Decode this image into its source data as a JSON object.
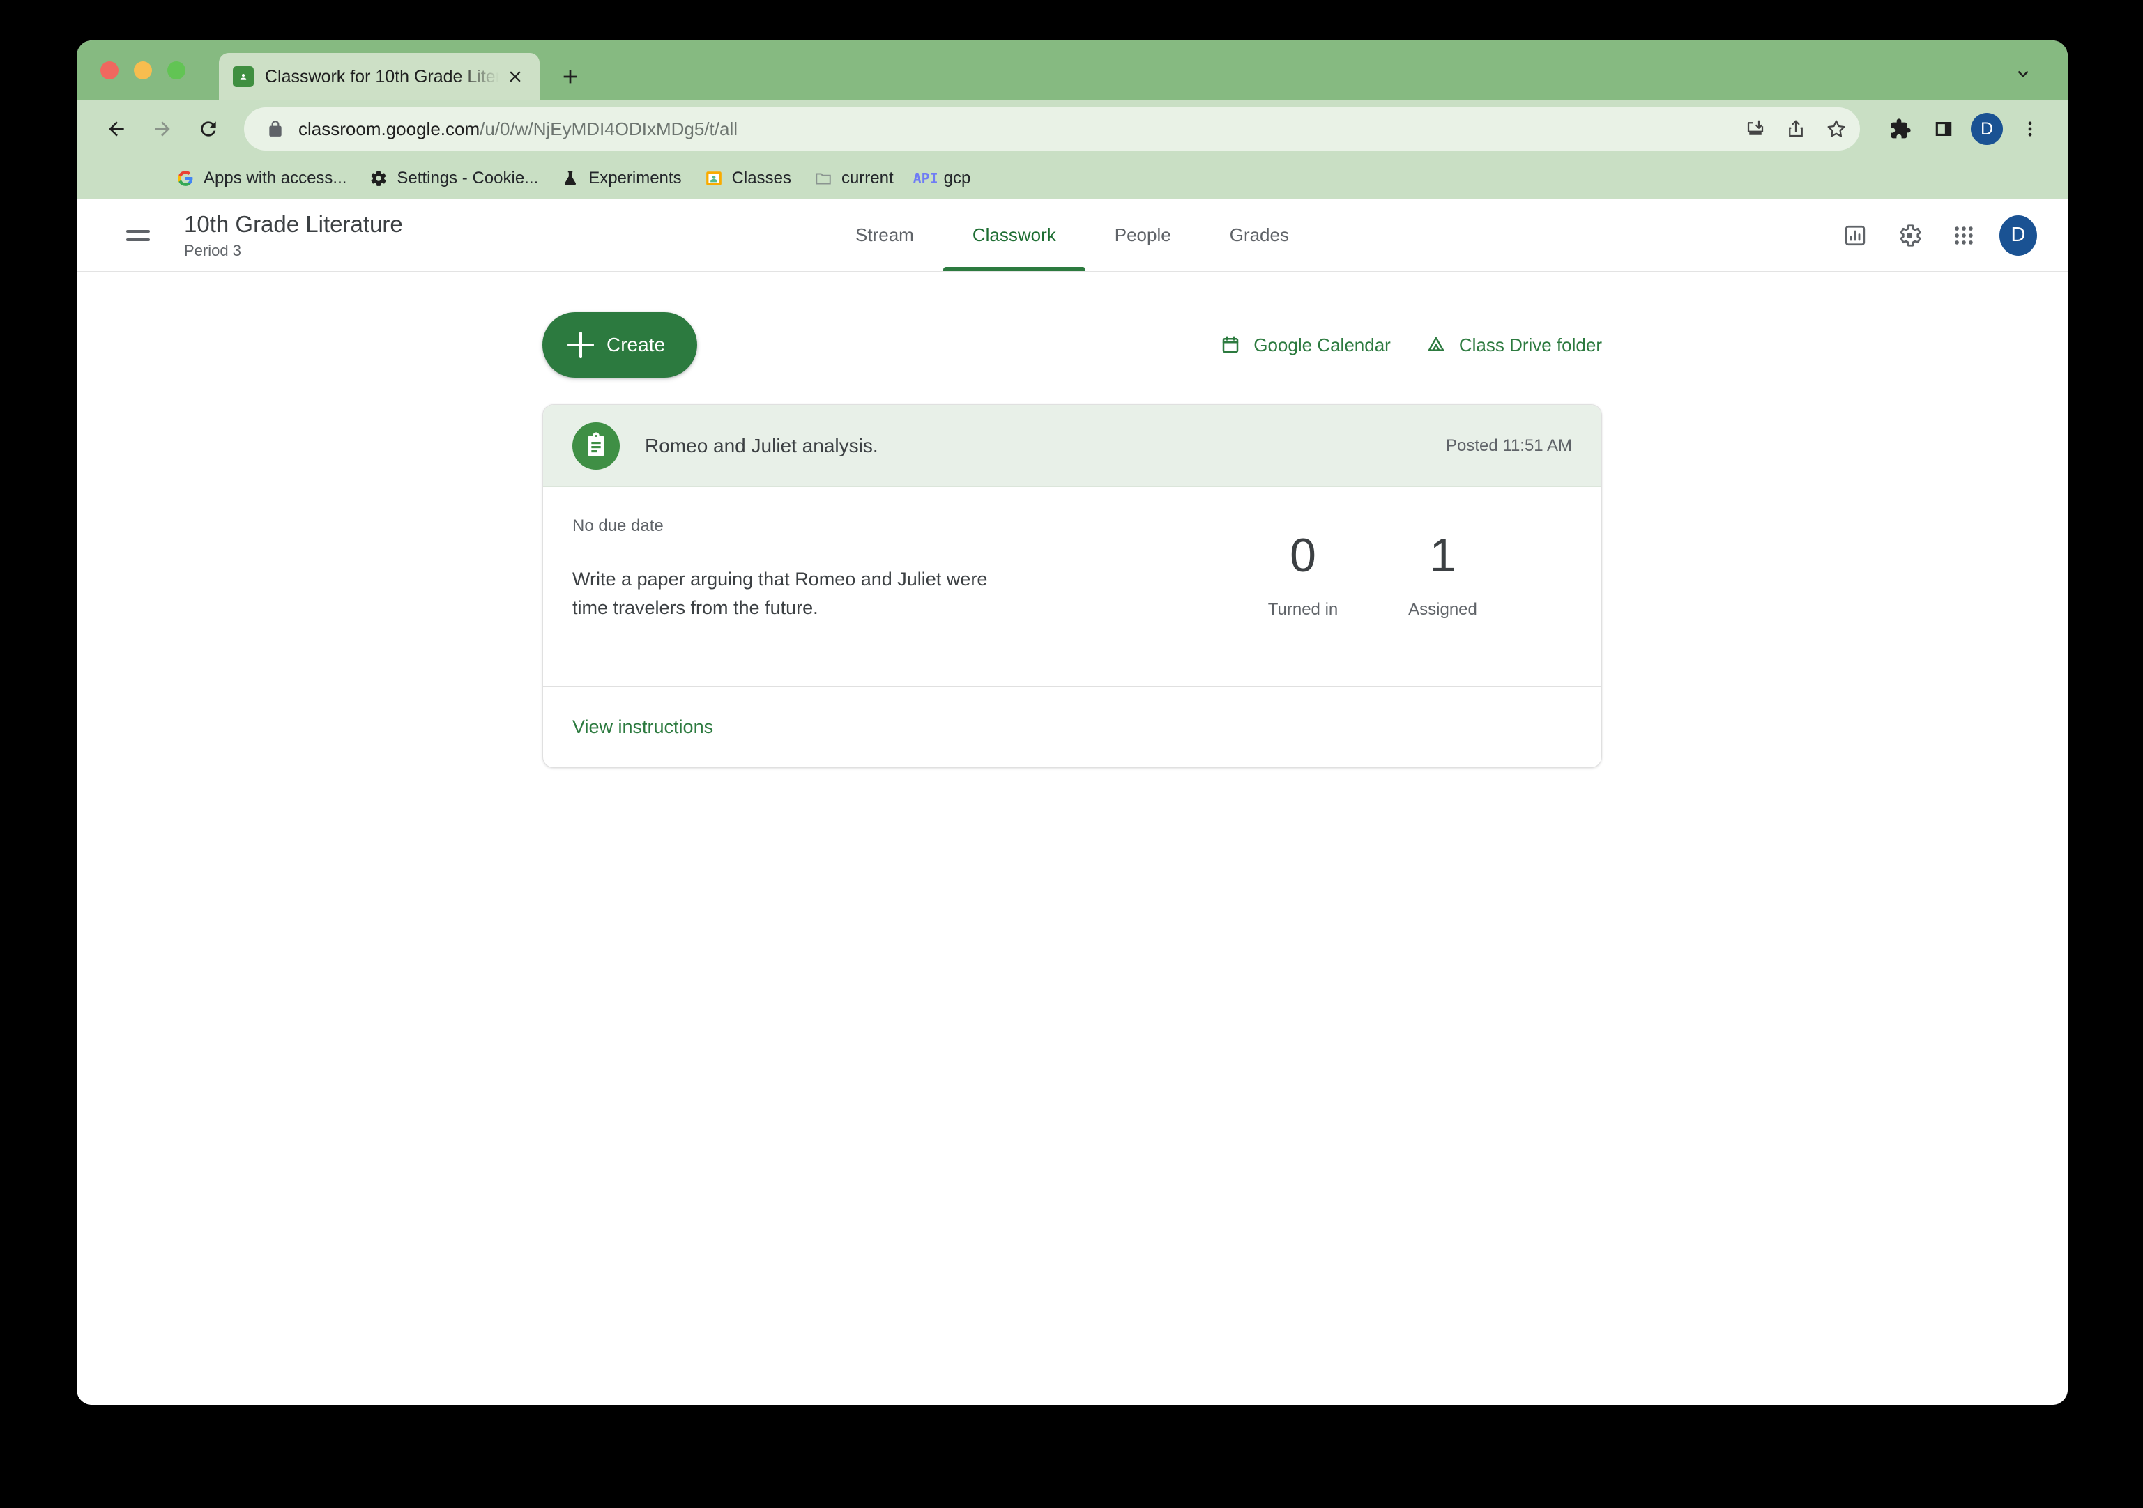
{
  "browser": {
    "tab": {
      "title": "Classwork for 10th Grade Liter",
      "favicon": "classroom-icon",
      "close": "close-icon"
    },
    "new_tab": "+",
    "omnibox": {
      "lock": "lock-icon",
      "url_host": "classroom.google.com",
      "url_path": "/u/0/w/NjEyMDI4ODIxMDg5/t/all"
    },
    "toolbar_icons": [
      "back-icon",
      "forward-icon",
      "reload-icon",
      "install-icon",
      "share-icon",
      "bookmark-star-icon",
      "extensions-icon",
      "side-panel-icon",
      "chrome-menu-icon"
    ],
    "chrome_avatar": "D",
    "bookmarks": [
      {
        "label": "Apps with access...",
        "icon": "google-icon"
      },
      {
        "label": "Settings - Cookie...",
        "icon": "gear-icon"
      },
      {
        "label": "Experiments",
        "icon": "flask-icon"
      },
      {
        "label": "Classes",
        "icon": "classroom-icon"
      },
      {
        "label": "current",
        "icon": "folder-icon"
      },
      {
        "label": "gcp",
        "icon": "api-icon"
      }
    ]
  },
  "classroom": {
    "header": {
      "menu": "hamburger-icon",
      "class_title": "10th Grade Literature",
      "class_section": "Period 3",
      "tabs": [
        {
          "label": "Stream",
          "active": false
        },
        {
          "label": "Classwork",
          "active": true
        },
        {
          "label": "People",
          "active": false
        },
        {
          "label": "Grades",
          "active": false
        }
      ],
      "right_icons": [
        "class-insights-icon",
        "settings-gear-icon",
        "apps-grid-icon"
      ],
      "avatar": "D"
    },
    "actions": {
      "create_label": "Create",
      "quick_links": [
        {
          "label": "Google Calendar",
          "icon": "calendar-icon"
        },
        {
          "label": "Class Drive folder",
          "icon": "drive-icon"
        }
      ]
    },
    "assignment": {
      "icon": "assignment-clipboard-icon",
      "title": "Romeo and Juliet analysis.",
      "posted": "Posted 11:51 AM",
      "due_date": "No due date",
      "description": "Write a paper arguing that Romeo and Juliet were time travelers from the future.",
      "counts": [
        {
          "value": "0",
          "label": "Turned in"
        },
        {
          "value": "1",
          "label": "Assigned"
        }
      ],
      "view_instructions": "View instructions"
    },
    "help": "help-icon"
  },
  "colors": {
    "brand_green": "#2c7a3f",
    "tab_strip": "#86ba81",
    "toolbar": "#c9dfc4",
    "card_header": "#e8f0e8",
    "avatar_blue": "#1a5293"
  }
}
